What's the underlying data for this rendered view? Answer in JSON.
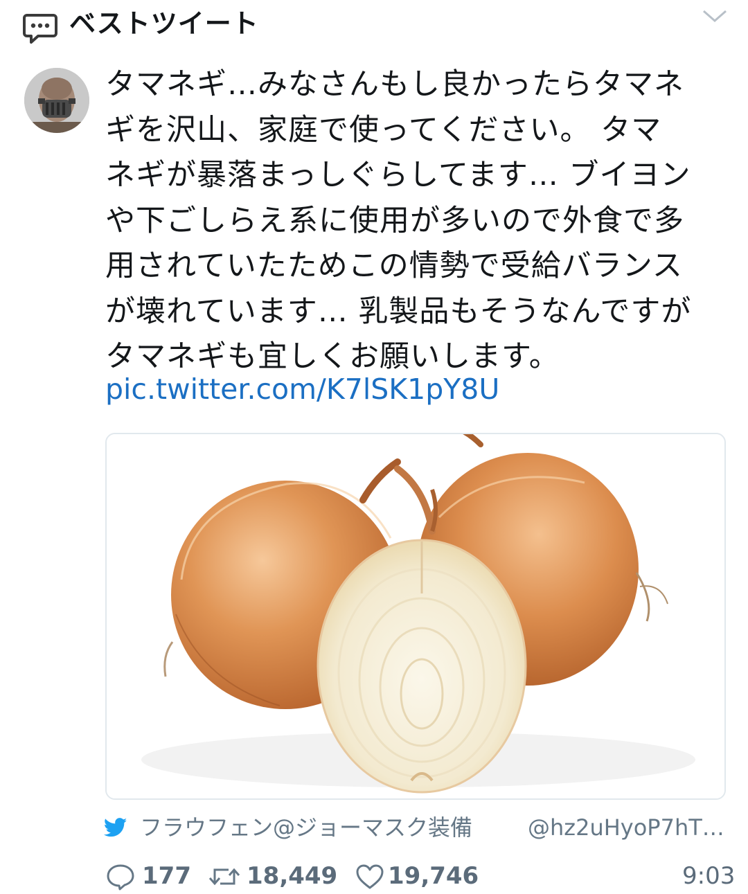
{
  "header": {
    "title": "ベストツイート",
    "icon": "speech-bubble-icon",
    "menu_icon": "chevron-down-icon"
  },
  "tweet": {
    "text": "タマネギ…みなさんもし良かったらタマネ\nギを沢山、家庭で使ってください。 タマ\nネギが暴落まっしぐらしてます… ブイヨン\nや下ごしらえ系に使用が多いので外食で多\n用されていたためこの情勢で受給バランス\nが壊れています… 乳製品もそうなんですが\nタマネギも宜しくお願いします。",
    "link": "pic.twitter.com/K7lSK1pY8U",
    "media_icon": "onion-photo"
  },
  "source": {
    "icon": "twitter-bird-icon",
    "name": "フラウフェン@ジョーマスク装備",
    "handle": "@hz2uHyoP7hT…"
  },
  "actions": {
    "replies": "177",
    "retweets": "18,449",
    "likes": "19,746",
    "time": "9:03"
  },
  "colors": {
    "link": "#1b6fc3",
    "twitter_blue": "#1da1f2",
    "muted": "#657786"
  }
}
